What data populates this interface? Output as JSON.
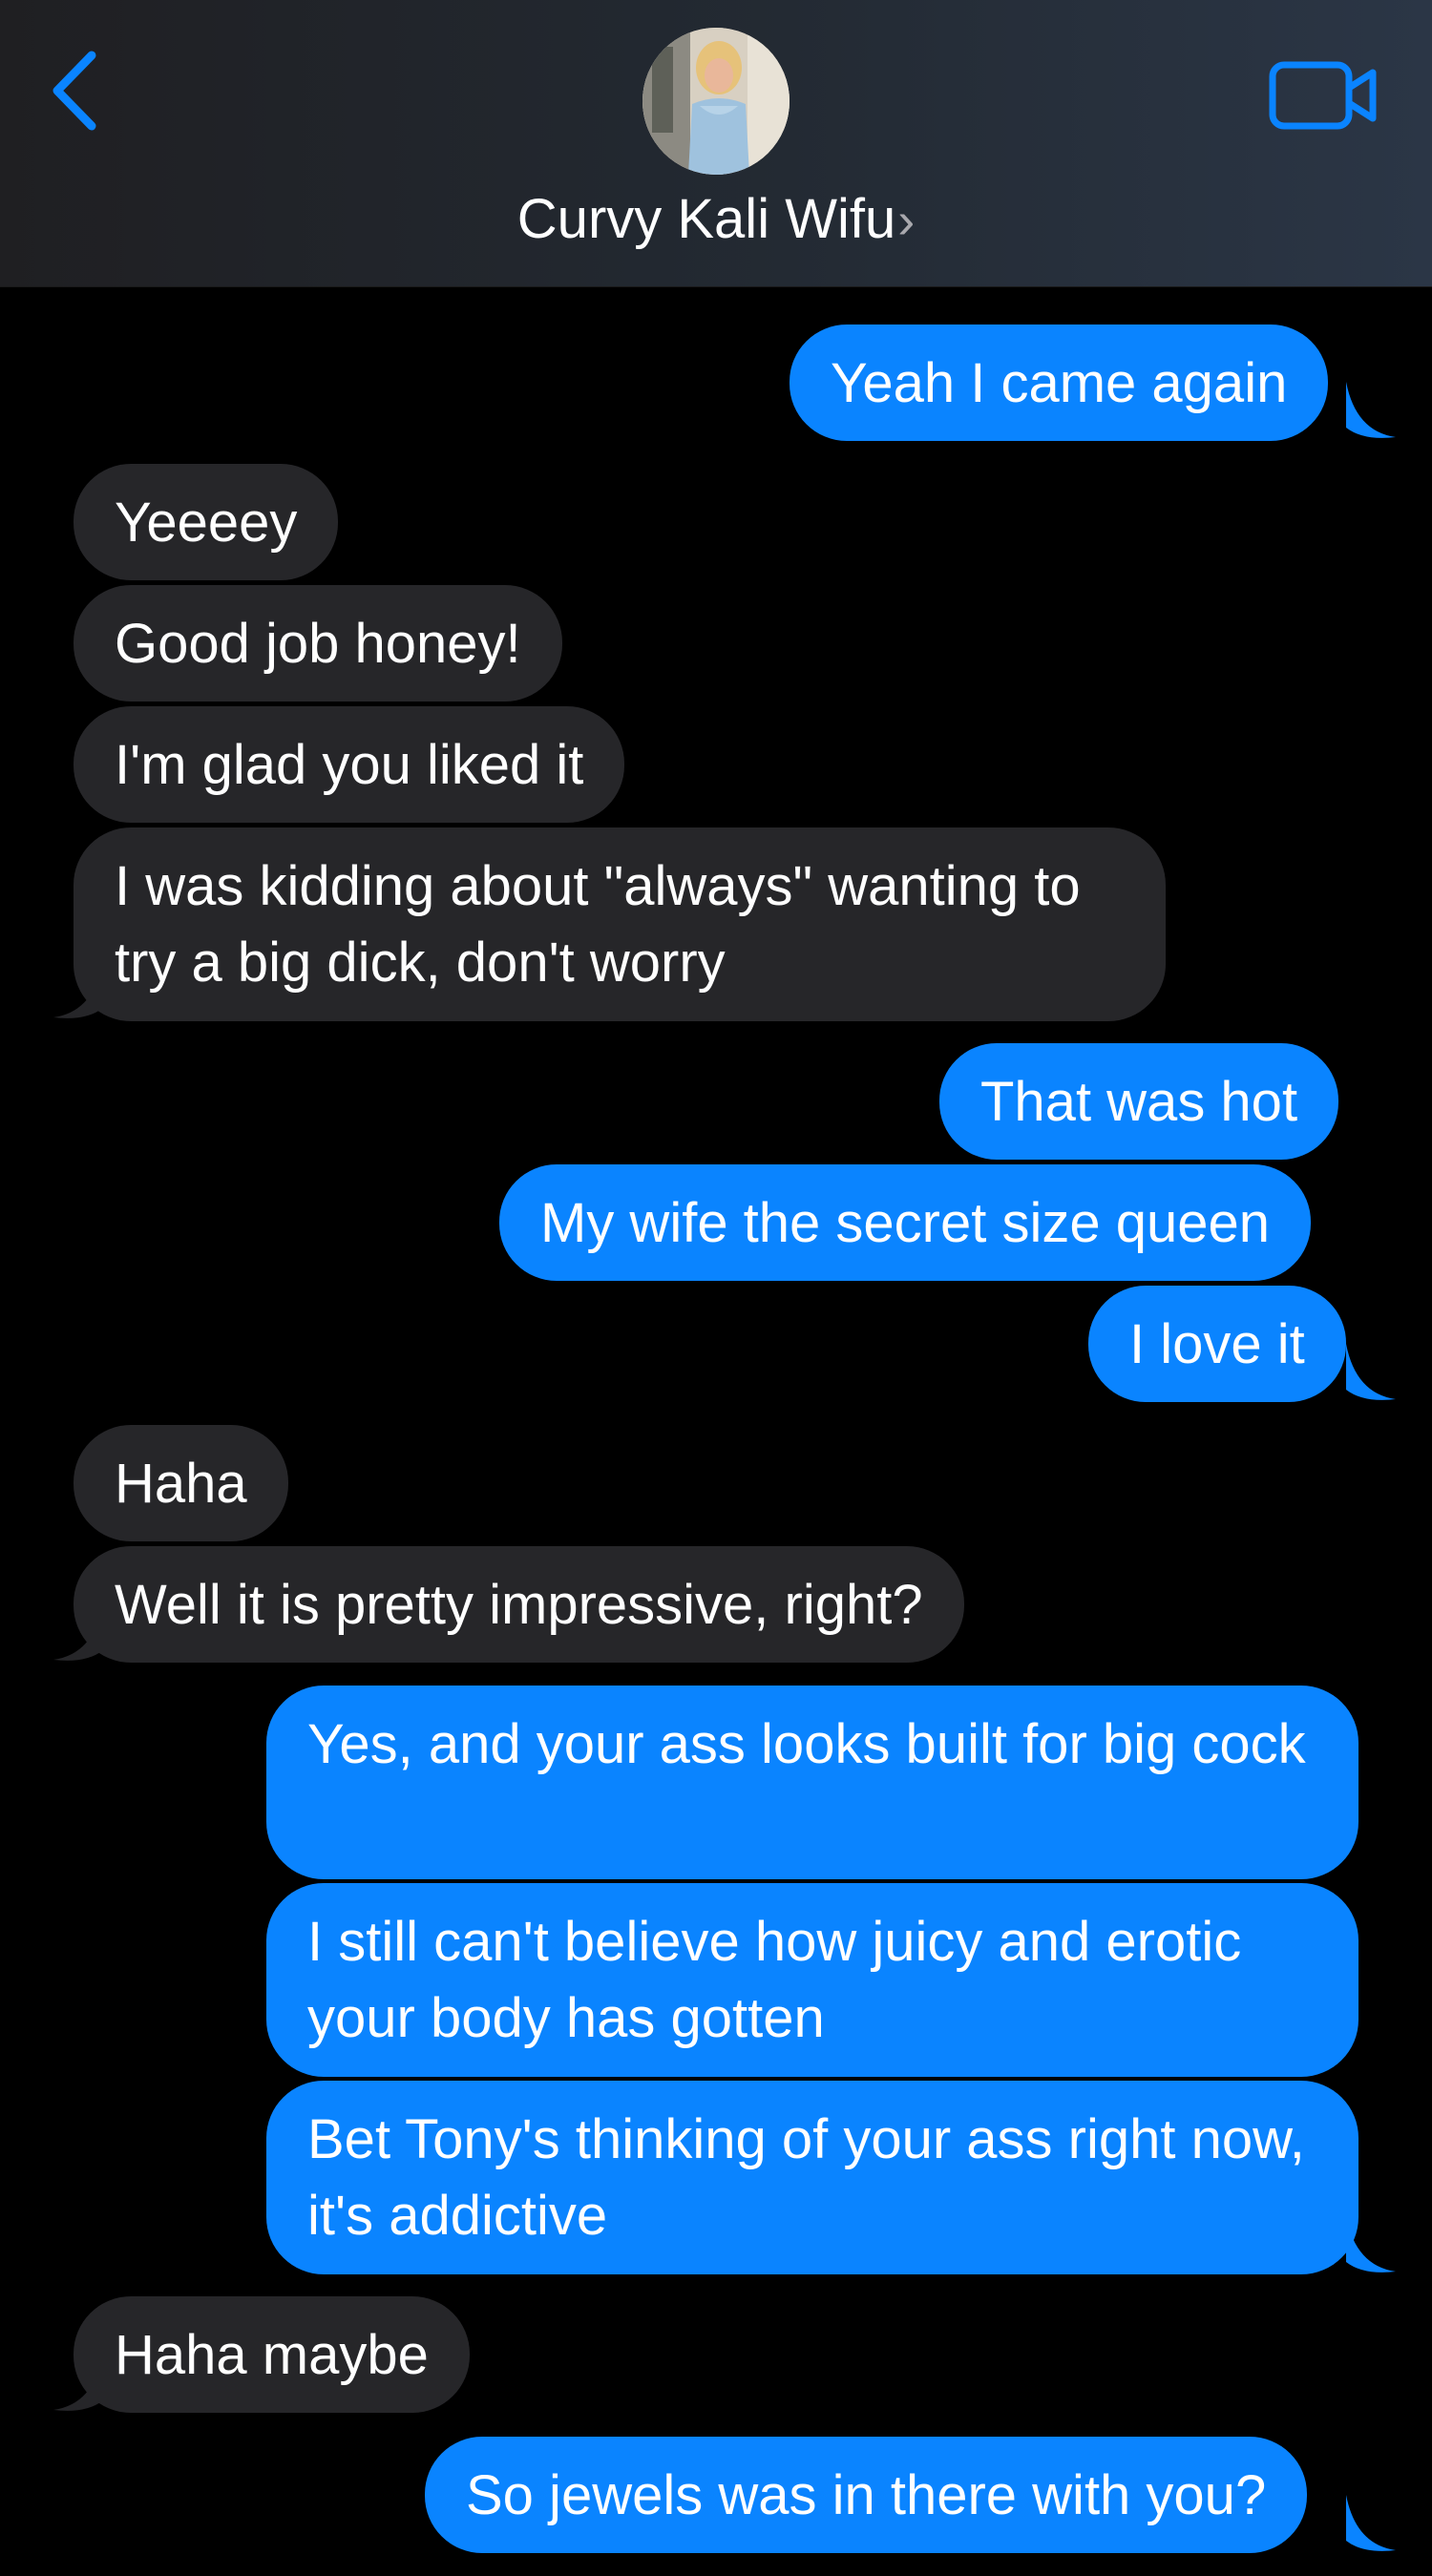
{
  "header": {
    "contact_name": "Curvy Kali Wifu",
    "chevron": "›",
    "back_icon": "chevron-left-icon",
    "video_icon": "video-camera-icon",
    "accent_color": "#0a84ff"
  },
  "messages": [
    {
      "dir": "out",
      "text": "Yeah I came again"
    },
    {
      "dir": "in",
      "text": "Yeeeey"
    },
    {
      "dir": "in",
      "text": "Good job honey!"
    },
    {
      "dir": "in",
      "text": "I'm glad you liked it"
    },
    {
      "dir": "in",
      "text": "I was kidding about \"always\" wanting to try a big dick, don't worry"
    },
    {
      "dir": "out",
      "text": "That was hot"
    },
    {
      "dir": "out",
      "text": "My wife the secret size queen"
    },
    {
      "dir": "out",
      "text": "I love it"
    },
    {
      "dir": "in",
      "text": "Haha"
    },
    {
      "dir": "in",
      "text": "Well it is pretty impressive, right?"
    },
    {
      "dir": "out",
      "text": "Yes, and your ass looks built for big cock"
    },
    {
      "dir": "out",
      "text": "I still can't believe how juicy and erotic your body has gotten"
    },
    {
      "dir": "out",
      "text": "Bet Tony's thinking of your ass right now, it's addictive"
    },
    {
      "dir": "in",
      "text": "Haha maybe"
    },
    {
      "dir": "out",
      "text": "So jewels was in there with you?"
    }
  ],
  "colors": {
    "incoming_bubble": "#262629",
    "outgoing_bubble": "#0a84ff",
    "background": "#000000"
  }
}
